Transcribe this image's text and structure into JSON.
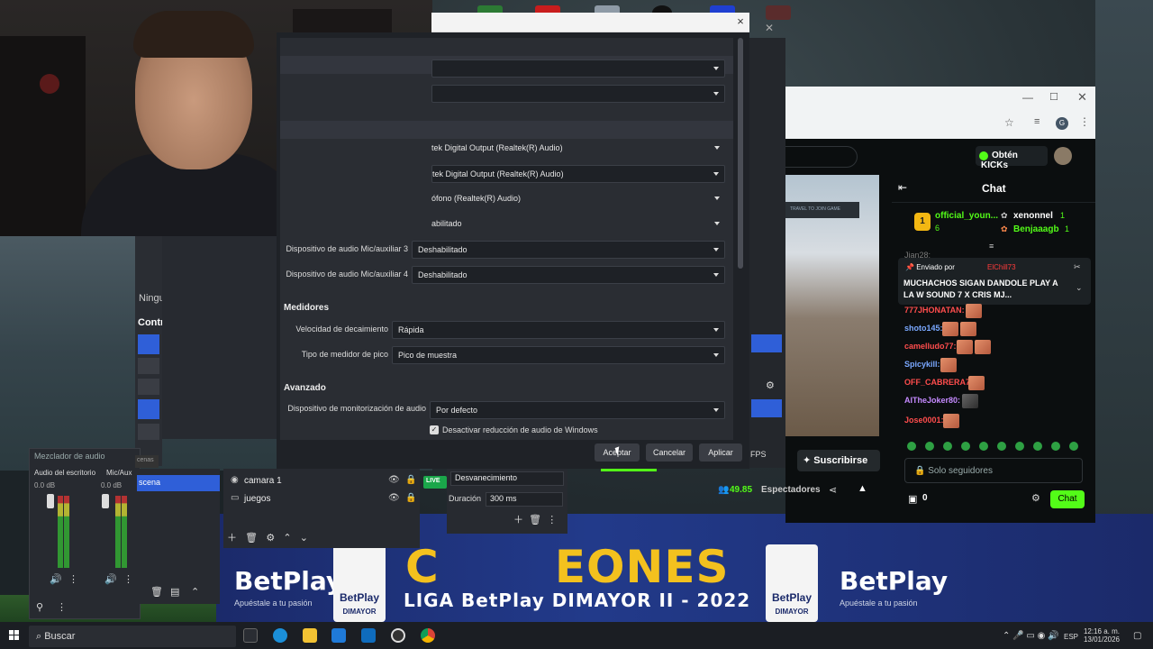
{
  "obs_settings": {
    "devices": [
      {
        "label": "",
        "value": ""
      },
      {
        "label": "",
        "value": ""
      },
      {
        "label": "",
        "value": "tek Digital Output (Realtek(R) Audio)"
      },
      {
        "label": "",
        "value": "tek Digital Output (Realtek(R) Audio)"
      },
      {
        "label": "",
        "value": "ófono (Realtek(R) Audio)"
      },
      {
        "label": "",
        "value": "abilitado"
      },
      {
        "label": "Dispositivo de audio Mic/auxiliar 3",
        "value": "Deshabilitado"
      },
      {
        "label": "Dispositivo de audio Mic/auxiliar 4",
        "value": "Deshabilitado"
      }
    ],
    "meters": {
      "section": "Medidores",
      "decay_label": "Velocidad de decaimiento",
      "decay_value": "Rápida",
      "peak_label": "Tipo de medidor de pico",
      "peak_value": "Pico de muestra"
    },
    "advanced": {
      "section": "Avanzado",
      "monitor_label": "Dispositivo de monitorización de audio",
      "monitor_value": "Por defecto",
      "ducking_label": "Desactivar reducción de audio de Windows",
      "ducking_checked": true
    },
    "buttons": {
      "accept": "Aceptar",
      "cancel": "Cancelar",
      "apply": "Aplicar"
    },
    "close_icon": "×"
  },
  "obs_main": {
    "left_fragments": {
      "ningu": "Ningu",
      "contr": "Contr"
    },
    "fps": "FPS",
    "mixer": {
      "title": "Mezclador de audio",
      "channels": [
        {
          "name": "Audio del escritorio",
          "db": "0.0 dB"
        },
        {
          "name": "Mic/Aux",
          "db": "0.0 dB"
        }
      ]
    },
    "scenes": {
      "frame_tag": "cenas",
      "selected": "scena"
    },
    "sources": [
      {
        "name": "camara 1"
      },
      {
        "name": "juegos"
      }
    ],
    "transitions": {
      "type": "Desvanecimiento",
      "duration_label": "Duración",
      "duration_value": "300 ms"
    }
  },
  "kick": {
    "kicks_button": "Obtén KICKs",
    "chat_title": "Chat",
    "gift_top": {
      "rank": "1",
      "user": "official_youn...",
      "count": "6"
    },
    "gifters": [
      {
        "user": "xenonnel",
        "count": "1"
      },
      {
        "user": "Benjaaagb",
        "count": "1"
      }
    ],
    "faded_user": "Jian28:",
    "pinned": {
      "sent_by": "Enviado por",
      "user": "ElChill73",
      "message": "MUCHACHOS SIGAN DANDOLE PLAY A LA W SOUND 7 X CRIS MJ..."
    },
    "chat_lines": [
      {
        "user": "777JHONATAN:",
        "color": "#ff4d4d"
      },
      {
        "user": "shoto145:",
        "color": "#7aa8ff"
      },
      {
        "user": "camelludo77:",
        "color": "#ff4d4d"
      },
      {
        "user": "Spicykill:",
        "color": "#7aa8ff"
      },
      {
        "user": "OFF_CABRERA7:",
        "color": "#ff4d4d"
      },
      {
        "user": "AIThеJoker80:",
        "color": "#c58aff"
      },
      {
        "user": "Jose0001:",
        "color": "#ff4d4d"
      }
    ],
    "subscribe": "Suscribirse",
    "chat_placeholder": "Solo seguidores",
    "viewers_value": "49.85",
    "viewers_label": "Espectadores",
    "count_value": "0",
    "chat_button": "Chat",
    "video_tag": "TRAVEL TO JOIN GAME"
  },
  "stream_overlay": {
    "campeones": "EONES",
    "campeones_prefix": "C",
    "liga": "LIGA BetPlay DIMAYOR II - 2022",
    "betplay": "BetPlay",
    "betplay_sub": "Apuéstale a tu pasión",
    "shield_text": "BetPlay",
    "shield_sub": "DIMAYOR"
  },
  "taskbar": {
    "search": "Buscar",
    "lang": "ESP",
    "time": "12:16 a. m.",
    "date": "13/01/2026"
  }
}
